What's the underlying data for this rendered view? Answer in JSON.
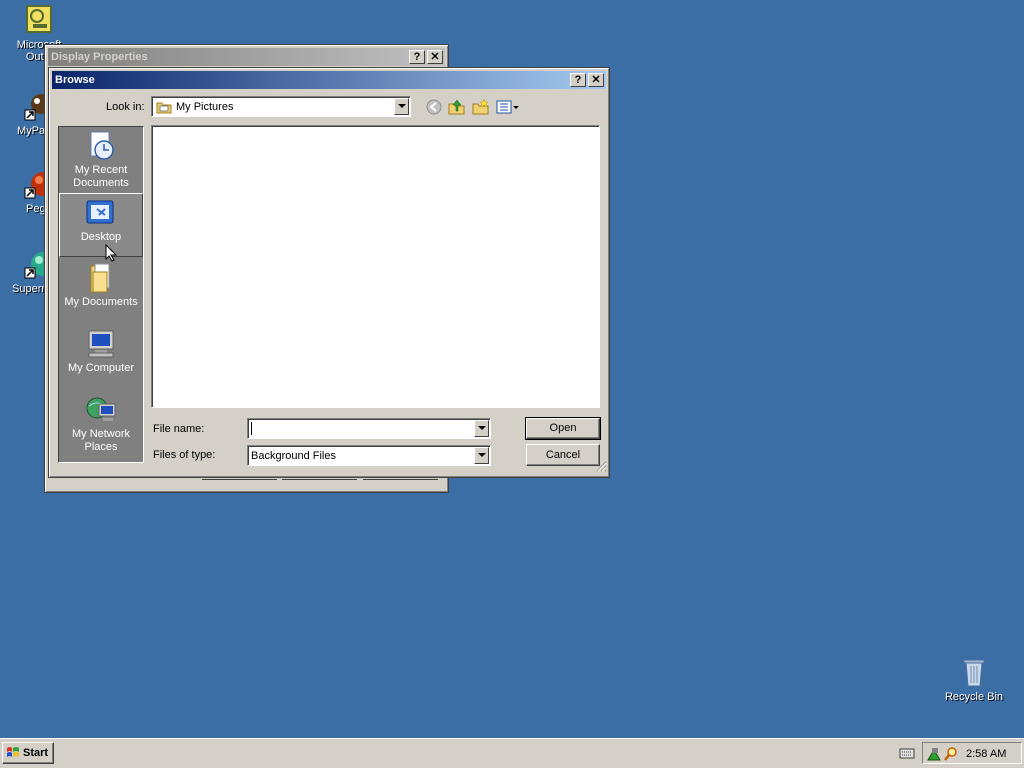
{
  "desktop": {
    "icons": [
      {
        "label": "Microsoft Outlook",
        "label_visible_1": "Microsoft",
        "label_visible_2": "Outlo"
      },
      {
        "label": "MyPa"
      },
      {
        "label": "Peg"
      },
      {
        "label": "Superm"
      },
      {
        "label": "Recycle Bin"
      }
    ]
  },
  "display_properties": {
    "title": "Display Properties",
    "help_btn": "?",
    "close_btn": "✕"
  },
  "browse": {
    "title": "Browse",
    "help_btn": "?",
    "close_btn": "✕",
    "look_in_label": "Look in:",
    "look_in_value": "My Pictures",
    "places": [
      {
        "line1": "My Recent",
        "line2": "Documents"
      },
      {
        "line1": "Desktop",
        "line2": ""
      },
      {
        "line1": "My Documents",
        "line2": ""
      },
      {
        "line1": "My Computer",
        "line2": ""
      },
      {
        "line1": "My Network",
        "line2": "Places"
      }
    ],
    "file_name_label": "File name:",
    "file_name_value": "",
    "files_of_type_label": "Files of type:",
    "files_of_type_value": "Background Files",
    "open_button": "Open",
    "cancel_button": "Cancel"
  },
  "taskbar": {
    "start_label": "Start",
    "clock": "2:58 AM"
  },
  "colors": {
    "desktop": "#3a6ea5",
    "title_active": "#0a246a",
    "face": "#d4d0c8"
  }
}
